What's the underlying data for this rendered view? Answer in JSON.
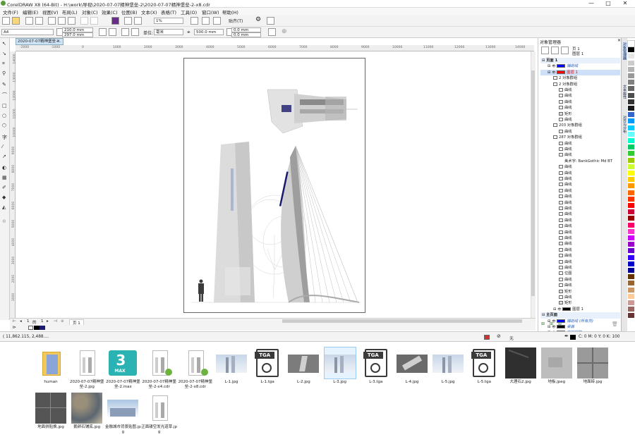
{
  "window": {
    "title": "CorelDRAW X8 (64-Bit) - H:\\work\\导视\\2020-07-07精神堡垒-2\\2020-07-07精神堡垒-2-x8.cdr",
    "controls": [
      "—",
      "□",
      "✕"
    ]
  },
  "menu": [
    "文件(F)",
    "编辑(E)",
    "视图(V)",
    "布局(L)",
    "对象(C)",
    "效果(C)",
    "位图(B)",
    "文本(X)",
    "表格(T)",
    "工具(O)",
    "窗口(W)",
    "帮助(H)"
  ],
  "toolbar": {
    "zoom": "1%",
    "snap_label": "贴齐(T)"
  },
  "property_bar": {
    "page_size": "A4",
    "width": "210.0 mm",
    "height": "297.0 mm",
    "unit_label": "单位:",
    "unit": "毫米",
    "nudge": "500.0 mm",
    "dup_x": "0.0 mm",
    "dup_y": "0.0 mm"
  },
  "document_tab": "2020-07-07精神堡垒-...",
  "ruler_h": [
    "-2000",
    "-1000",
    "0",
    "1000",
    "2000",
    "3000",
    "4000",
    "5000",
    "6000",
    "7000",
    "8000",
    "9000",
    "10000",
    "11000",
    "12000",
    "13000",
    "14000"
  ],
  "ruler_v": [
    "14000",
    "13000",
    "12000",
    "11000",
    "10000",
    "9000",
    "8000",
    "7000",
    "6000",
    "5000",
    "4000",
    "3000",
    "2000",
    "1000"
  ],
  "page_nav": {
    "current": "1",
    "of_label": "的",
    "total": "1",
    "page_tab": "页 1"
  },
  "object_manager": {
    "title": "对象管理器",
    "page_label": "页 1",
    "layer_label": "图层 1",
    "tree": [
      {
        "text": "页面 1",
        "level": 0,
        "type": "page"
      },
      {
        "text": "辅助线",
        "level": 1,
        "type": "layer",
        "color": "#0000ff",
        "italic": true
      },
      {
        "text": "图层 1",
        "level": 1,
        "type": "layer",
        "color": "#ff0000",
        "red": true
      },
      {
        "text": "2 对象群组",
        "level": 2,
        "type": "group"
      },
      {
        "text": "2 对象群组",
        "level": 2,
        "type": "group"
      },
      {
        "text": "曲线",
        "level": 3,
        "type": "curve"
      },
      {
        "text": "曲线",
        "level": 3,
        "type": "curve"
      },
      {
        "text": "曲线",
        "level": 3,
        "type": "curve"
      },
      {
        "text": "曲线",
        "level": 3,
        "type": "curve"
      },
      {
        "text": "矩形",
        "level": 3,
        "type": "rect"
      },
      {
        "text": "曲线",
        "level": 3,
        "type": "curve"
      },
      {
        "text": "203 对象群组",
        "level": 2,
        "type": "group"
      },
      {
        "text": "曲线",
        "level": 3,
        "type": "curve"
      },
      {
        "text": "287 对象群组",
        "level": 2,
        "type": "group"
      },
      {
        "text": "曲线",
        "level": 3,
        "type": "curve"
      },
      {
        "text": "曲线",
        "level": 3,
        "type": "curve"
      },
      {
        "text": "曲线",
        "level": 3,
        "type": "curve"
      },
      {
        "text": "美术字: BankGothic Md BT",
        "level": 3,
        "type": "text"
      },
      {
        "text": "曲线",
        "level": 3,
        "type": "curve"
      },
      {
        "text": "曲线",
        "level": 3,
        "type": "curve"
      },
      {
        "text": "曲线",
        "level": 3,
        "type": "curve"
      },
      {
        "text": "曲线",
        "level": 3,
        "type": "curve"
      },
      {
        "text": "曲线",
        "level": 3,
        "type": "curve"
      },
      {
        "text": "曲线",
        "level": 3,
        "type": "curve"
      },
      {
        "text": "曲线",
        "level": 3,
        "type": "curve"
      },
      {
        "text": "曲线",
        "level": 3,
        "type": "curve"
      },
      {
        "text": "曲线",
        "level": 3,
        "type": "curve"
      },
      {
        "text": "曲线",
        "level": 3,
        "type": "curve"
      },
      {
        "text": "曲线",
        "level": 3,
        "type": "curve"
      },
      {
        "text": "曲线",
        "level": 3,
        "type": "curve"
      },
      {
        "text": "曲线",
        "level": 3,
        "type": "curve"
      },
      {
        "text": "曲线",
        "level": 3,
        "type": "curve"
      },
      {
        "text": "曲线",
        "level": 3,
        "type": "curve"
      },
      {
        "text": "曲线",
        "level": 3,
        "type": "curve"
      },
      {
        "text": "曲线",
        "level": 3,
        "type": "curve"
      },
      {
        "text": "曲线",
        "level": 3,
        "type": "curve"
      },
      {
        "text": "位图",
        "level": 3,
        "type": "bitmap"
      },
      {
        "text": "曲线",
        "level": 3,
        "type": "curve"
      },
      {
        "text": "曲线",
        "level": 3,
        "type": "curve"
      },
      {
        "text": "矩形",
        "level": 3,
        "type": "rect"
      },
      {
        "text": "曲线",
        "level": 3,
        "type": "curve"
      },
      {
        "text": "矩形",
        "level": 3,
        "type": "rect"
      },
      {
        "text": "图层 1",
        "level": 2,
        "type": "layer",
        "color": "#000000"
      },
      {
        "text": "主页面",
        "level": 0,
        "type": "page"
      },
      {
        "text": "辅助线 (所有页)",
        "level": 1,
        "type": "layer",
        "color": "#0000ff",
        "italic": true
      },
      {
        "text": "桌面",
        "level": 1,
        "type": "layer",
        "color": "#000000",
        "italic": true
      },
      {
        "text": "文档网格",
        "level": 1,
        "type": "layer",
        "color": "#aaaaaa",
        "italic": true
      }
    ]
  },
  "docker_tabs": [
    "对象管理器",
    "文本属性",
    "对齐与分布"
  ],
  "palette": [
    "#ffffff",
    "#000000",
    "#e6e6e6",
    "#cccccc",
    "#b3b3b3",
    "#999999",
    "#808080",
    "#666666",
    "#4d4d4d",
    "#333333",
    "#1a1a1a",
    "#3366cc",
    "#0099ff",
    "#00ccff",
    "#66ffff",
    "#00ffcc",
    "#00cc66",
    "#33cc33",
    "#99cc00",
    "#ccff33",
    "#ffff00",
    "#ffcc00",
    "#ff9900",
    "#ff6600",
    "#ff3300",
    "#ff0000",
    "#cc0033",
    "#990000",
    "#ff0066",
    "#ff33cc",
    "#cc00ff",
    "#9900cc",
    "#6600cc",
    "#3300ff",
    "#0000cc",
    "#000099",
    "#663300",
    "#996633",
    "#cc9966",
    "#ffcc99",
    "#cc9999",
    "#996666",
    "#663333"
  ],
  "status": {
    "coords": "( 11,862.115, 2,488....",
    "fill_none": "无",
    "cmyk": "C: 0 M: 0 Y: 0 K: 100"
  },
  "files": [
    {
      "name": "human",
      "kind": "folder"
    },
    {
      "name": "2020-07-07精神堡垒-2.jpg",
      "kind": "doc"
    },
    {
      "name": "2020-07-07精神堡垒-2.max",
      "kind": "max"
    },
    {
      "name": "2020-07-07精神堡垒-2-x4.cdr",
      "kind": "cdr"
    },
    {
      "name": "2020-07-07精神堡垒-2-x8.cdr",
      "kind": "cdr"
    },
    {
      "name": "L-1.jpg",
      "kind": "city"
    },
    {
      "name": "L-1.tga",
      "kind": "tga"
    },
    {
      "name": "L-2.jpg",
      "kind": "gray"
    },
    {
      "name": "L-3.jpg",
      "kind": "city",
      "selected": true
    },
    {
      "name": "L-3.tga",
      "kind": "tga"
    },
    {
      "name": "L-4.jpg",
      "kind": "gray2"
    },
    {
      "name": "L-5.jpg",
      "kind": "city"
    },
    {
      "name": "L-5.tga",
      "kind": "tga"
    },
    {
      "name": "大理石2.jpg",
      "kind": "marble"
    },
    {
      "name": "地板.jpeg",
      "kind": "stone"
    },
    {
      "name": "地面砖.jpg",
      "kind": "tile"
    },
    {
      "name": "地面拼贴换.jpg",
      "kind": "granite"
    },
    {
      "name": "鹅卵石铺底.jpg",
      "kind": "pebble"
    },
    {
      "name": "金融城市背景贴图.jpg",
      "kind": "skyline"
    },
    {
      "name": "正面镂空发光道草.jpg",
      "kind": "doc"
    }
  ],
  "colors": {
    "accent": "#3d8ee6",
    "navy": "#1a1a6e",
    "dark_bg": "#3a3a3a",
    "max_teal": "#2bb3b3"
  }
}
